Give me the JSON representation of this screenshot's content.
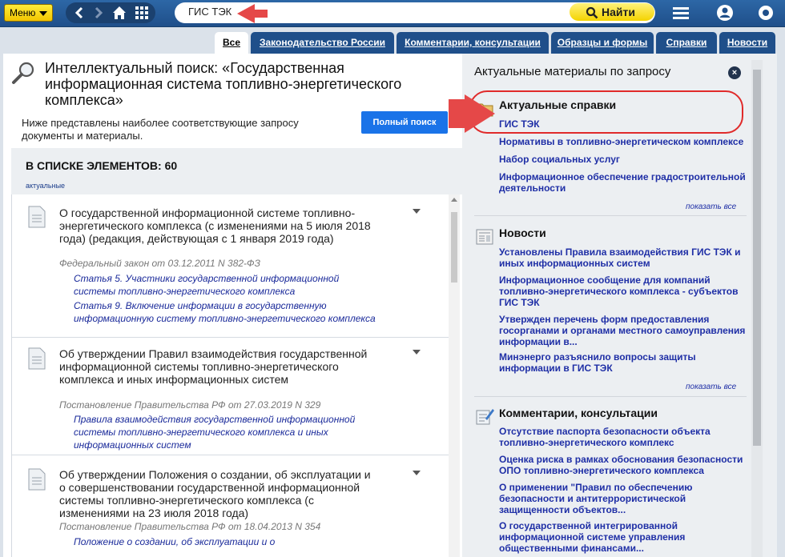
{
  "toolbar": {
    "menu_label": "Меню",
    "search_value": "ГИС ТЭК",
    "find_label": "Найти"
  },
  "tabs": [
    {
      "label": "Все"
    },
    {
      "label": "Законодательство России"
    },
    {
      "label": "Комментарии, консультации"
    },
    {
      "label": "Образцы и формы"
    },
    {
      "label": "Справки"
    },
    {
      "label": "Новости"
    }
  ],
  "main": {
    "title": "Интеллектуальный поиск: «Государственная информационная система топливно-энергетического комплекса»",
    "subtitle": "Ниже представлены наиболее соответствующие запросу документы и материалы.",
    "full_search_label": "Полный поиск",
    "count_label": "В СПИСКЕ ЭЛЕМЕНТОВ: 60",
    "count_sub": "актуальные"
  },
  "documents": [
    {
      "title": "О государственной информационной системе топливно-энергетического комплекса (с изменениями на 5 июля 2018 года) (редакция, действующая с 1 января 2019 года)",
      "meta": "Федеральный закон от 03.12.2011 N 382-ФЗ",
      "links": [
        "Статья 5. Участники государственной информационной системы топливно-энергетического комплекса",
        "Статья 9. Включение информации в государственную информационную систему топливно-энергетического комплекса"
      ]
    },
    {
      "title": "Об утверждении Правил взаимодействия государственной информационной системы топливно-энергетического комплекса и иных информационных систем",
      "meta": "Постановление Правительства РФ от 27.03.2019 N 329",
      "links": [
        "Правила взаимодействия государственной информационной системы топливно-энергетического комплекса и иных информационных систем"
      ]
    },
    {
      "title": "Об утверждении Положения о создании, об эксплуатации и о совершенствовании государственной информационной системы топливно-энергетического комплекса (с изменениями на 23 июля 2018 года)",
      "meta": "Постановление Правительства РФ от 18.04.2013 N 354",
      "links": [
        "Положение о создании, об эксплуатации и о"
      ]
    }
  ],
  "right_panel": {
    "title": "Актуальные материалы по запросу",
    "show_all": "показать все",
    "sections": [
      {
        "title": "Актуальные справки",
        "icon": "folder-icon",
        "items": [
          "ГИС ТЭК",
          "Нормативы в топливно-энергетическом комплексе",
          "Набор социальных услуг",
          "Информационное обеспечение градостроительной деятельности"
        ]
      },
      {
        "title": "Новости",
        "icon": "newspaper-icon",
        "items": [
          "Установлены Правила взаимодействия ГИС ТЭК и иных информационных систем",
          "Информационное сообщение для компаний топливно-энергетического комплекса - субъектов ГИС ТЭК",
          "Утвержден перечень форм предоставления госорганами и органами местного самоуправления информации в...",
          "Минэнерго разъяснило вопросы защиты информации в ГИС ТЭК"
        ]
      },
      {
        "title": "Комментарии, консультации",
        "icon": "notepad-pencil-icon",
        "items": [
          "Отсутствие паспорта безопасности объекта топливно-энергетического комплекс",
          "Оценка риска в рамках обоснования безопасности ОПО топливно-энергетического комплекса",
          "О применении \"Правил по обеспечению безопасности и антитеррористической защищенности объектов...",
          "О государственной интегрированной информационной системе управления общественными финансами..."
        ]
      }
    ]
  },
  "colors": {
    "toolbar_blue": "#1f4f8a",
    "menu_yellow": "#f2c500",
    "find_yellow": "#f4d300",
    "link_blue": "#1f2fa6",
    "highlight_red": "#e02a2a",
    "button_blue": "#1a73e8"
  }
}
